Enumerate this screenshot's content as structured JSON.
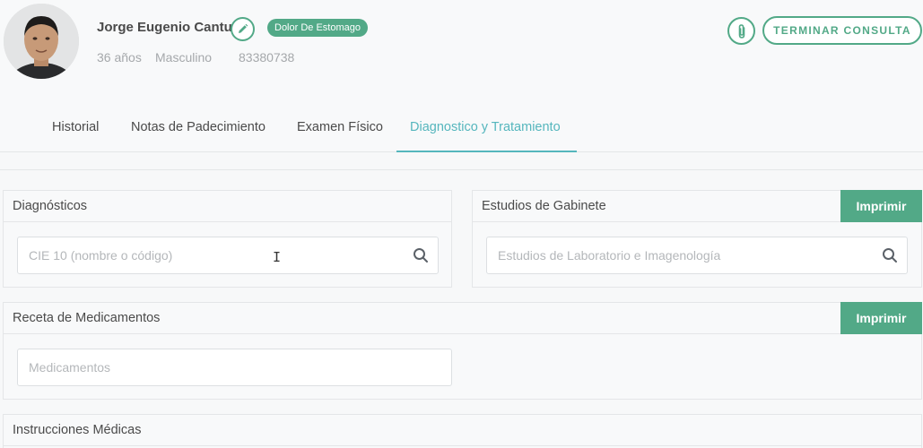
{
  "patient": {
    "name": "Jorge Eugenio Cantu",
    "tag": "Dolor De Estomago",
    "age": "36 años",
    "gender": "Masculino",
    "id": "83380738"
  },
  "actions": {
    "end_consult": "TERMINAR CONSULTA"
  },
  "tabs": [
    {
      "label": "Historial"
    },
    {
      "label": "Notas de Padecimiento"
    },
    {
      "label": "Examen Físico"
    },
    {
      "label": "Diagnostico y Tratamiento"
    }
  ],
  "panels": {
    "diagnosticos": {
      "title": "Diagnósticos",
      "placeholder": "CIE 10 (nombre o código)"
    },
    "estudios": {
      "title": "Estudios de Gabinete",
      "print": "Imprimir",
      "placeholder": "Estudios de Laboratorio e Imagenología"
    },
    "receta": {
      "title": "Receta de Medicamentos",
      "print": "Imprimir",
      "placeholder": "Medicamentos"
    },
    "instrucciones": {
      "title": "Instrucciones Médicas"
    }
  },
  "colors": {
    "accent": "#52a987",
    "tab_active": "#55b6bd"
  },
  "icons": {
    "edit": "pencil-icon",
    "attach": "paperclip-icon",
    "search": "search-icon"
  }
}
